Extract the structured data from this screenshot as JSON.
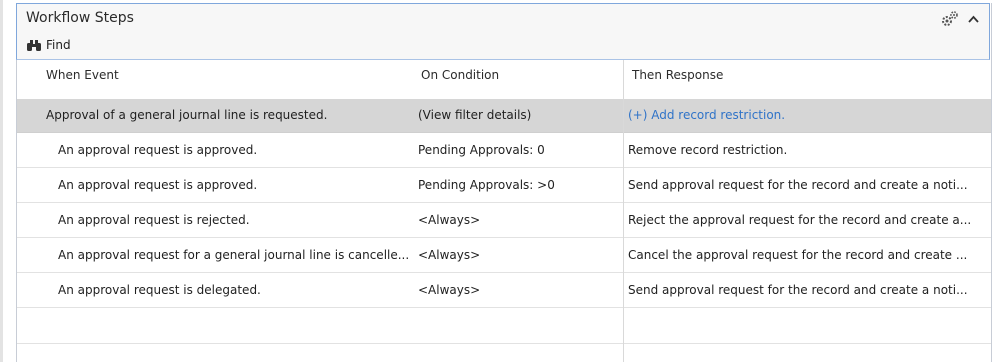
{
  "panel": {
    "title": "Workflow Steps",
    "find_label": "Find"
  },
  "columns": {
    "when_event": "When Event",
    "on_condition": "On Condition",
    "then_response": "Then Response"
  },
  "rows": [
    {
      "event": "Approval of a general journal line is requested.",
      "condition": "(View filter details)",
      "response": "(+) Add record restriction.",
      "selected": true
    },
    {
      "event": "An approval request is approved.",
      "condition": "Pending Approvals: 0",
      "response": "Remove record restriction.",
      "selected": false
    },
    {
      "event": "An approval request is approved.",
      "condition": "Pending Approvals: >0",
      "response": "Send approval request for the record and create a noti...",
      "selected": false
    },
    {
      "event": "An approval request is rejected.",
      "condition": "<Always>",
      "response": "Reject the approval request for the record and create a...",
      "selected": false
    },
    {
      "event": "An approval request for a general journal line is cancelle...",
      "condition": "<Always>",
      "response": "Cancel the approval request for the record and create ...",
      "selected": false
    },
    {
      "event": "An approval request is delegated.",
      "condition": "<Always>",
      "response": "Send approval request for the record and create a noti...",
      "selected": false
    }
  ],
  "icons": {
    "settings": "gear-icon",
    "collapse": "chevron-up-icon",
    "find": "binoculars-icon"
  },
  "colors": {
    "accent_border": "#7fa7dc",
    "selected_row": "#d6d6d6",
    "link": "#2f73c8"
  }
}
